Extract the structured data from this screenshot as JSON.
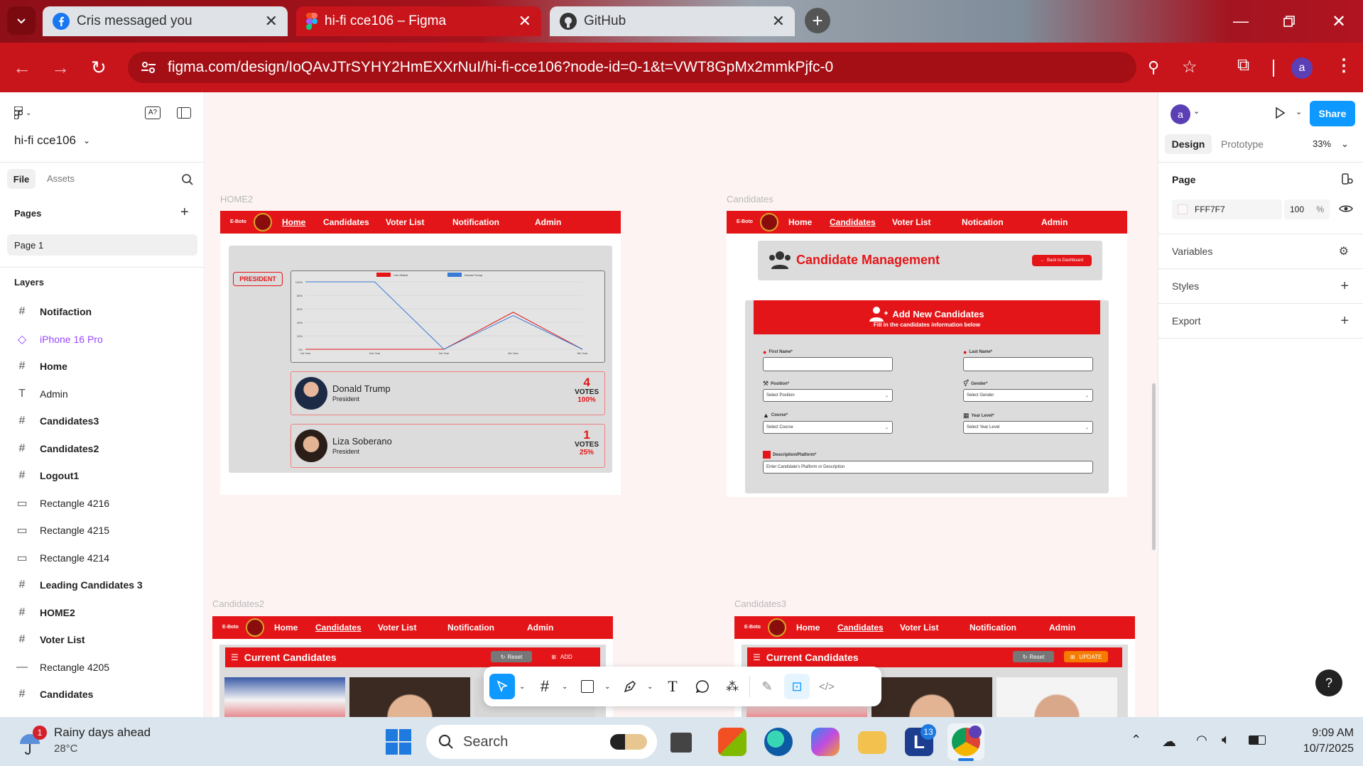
{
  "browser": {
    "tabs": [
      {
        "title": "Cris messaged you",
        "icon": "facebook-icon"
      },
      {
        "title": "hi-fi cce106 – Figma",
        "icon": "figma-icon",
        "active": true
      },
      {
        "title": "GitHub",
        "icon": "github-icon"
      }
    ],
    "url": "figma.com/design/IoQAvJTrSYHY2HmEXXrNuI/hi-fi-cce106?node-id=0-1&t=VWT8GpMx2mmkPjfc-0",
    "avatar_letter": "a"
  },
  "left_panel": {
    "file_name": "hi-fi cce106",
    "tabs": [
      "File",
      "Assets"
    ],
    "pages_label": "Pages",
    "current_page": "Page 1",
    "layers_label": "Layers",
    "layers": [
      {
        "name": "Notifaction",
        "type": "frame"
      },
      {
        "name": "iPhone 16 Pro",
        "type": "component"
      },
      {
        "name": "Home",
        "type": "frame"
      },
      {
        "name": "Admin",
        "type": "text"
      },
      {
        "name": "Candidates3",
        "type": "frame"
      },
      {
        "name": "Candidates2",
        "type": "frame"
      },
      {
        "name": "Logout1",
        "type": "frame"
      },
      {
        "name": "Rectangle 4216",
        "type": "rect"
      },
      {
        "name": "Rectangle 4215",
        "type": "rect"
      },
      {
        "name": "Rectangle 4214",
        "type": "rect"
      },
      {
        "name": "Leading Candidates 3",
        "type": "frame"
      },
      {
        "name": "HOME2",
        "type": "frame"
      },
      {
        "name": "Voter List",
        "type": "frame"
      },
      {
        "name": "Rectangle 4205",
        "type": "line"
      },
      {
        "name": "Candidates",
        "type": "frame"
      }
    ]
  },
  "right_panel": {
    "avatar_letter": "a",
    "share_label": "Share",
    "tabs": [
      "Design",
      "Prototype"
    ],
    "zoom": "33%",
    "page_label": "Page",
    "page_color": "FFF7F7",
    "page_opacity": "100",
    "percent": "%",
    "sections": [
      "Variables",
      "Styles",
      "Export"
    ]
  },
  "nav": {
    "brand": "E-Boto",
    "home": "Home",
    "candidates": "Candidates",
    "voter_list": "Voter List",
    "notification": "Notification",
    "notication": "Notication",
    "admin": "Admin"
  },
  "home2": {
    "label": "HOME2",
    "badge": "PRESIDENT",
    "candidates": [
      {
        "name": "Donald Trump",
        "role": "President",
        "votes": "4",
        "votes_label": "VOTES",
        "percent": "100%"
      },
      {
        "name": "Liza Soberano",
        "role": "President",
        "votes": "1",
        "votes_label": "VOTES",
        "percent": "25%"
      }
    ]
  },
  "chart_data": {
    "type": "line",
    "categories": [
      "1st Year",
      "2nd Year",
      "3rd Year",
      "4th Year",
      "5th Year"
    ],
    "series": [
      {
        "name": "Cris Skibidi",
        "color": "#e41518",
        "values": [
          0,
          0,
          0,
          55,
          0
        ]
      },
      {
        "name": "Donald Trump",
        "color": "#3a7bd5",
        "values": [
          100,
          100,
          0,
          50,
          0
        ]
      }
    ],
    "yticks": [
      "0%",
      "20%",
      "40%",
      "60%",
      "80%",
      "100%"
    ],
    "ylim": [
      0,
      100
    ],
    "legend": "top"
  },
  "candidates_frame": {
    "label": "Candidates",
    "title": "Candidate Management",
    "back_button": "Back to Dashboard",
    "add_title": "Add New Candidates",
    "add_subtitle": "Fill in the candidates information below",
    "first_name": "First Name*",
    "last_name": "Last Name*",
    "position": "Position*",
    "position_placeholder": "Select Position",
    "gender": "Gender*",
    "gender_placeholder": "Select Gender",
    "course": "Course*",
    "course_placeholder": "Select Course",
    "year_level": "Year Level*",
    "year_placeholder": "Select Year Level",
    "description": "Description/Platform*",
    "description_placeholder": "Enter Candidate's Platform or Description"
  },
  "candidates2": {
    "label": "Candidates2",
    "title": "Current Candidates",
    "reset": "Reset",
    "add": "ADD"
  },
  "candidates3": {
    "label": "Candidates3",
    "title": "Current Candidates",
    "reset": "Reset",
    "update": "UPDATE"
  },
  "taskbar": {
    "weather_title": "Rainy days ahead",
    "temperature": "28°C",
    "weather_badge": "1",
    "search": "Search",
    "l_badge": "13",
    "time": "9:09 AM",
    "date": "10/7/2025"
  },
  "colors": {
    "brand_red": "#e41518",
    "chrome_red": "#c8151b",
    "figma_blue": "#0d99ff"
  }
}
